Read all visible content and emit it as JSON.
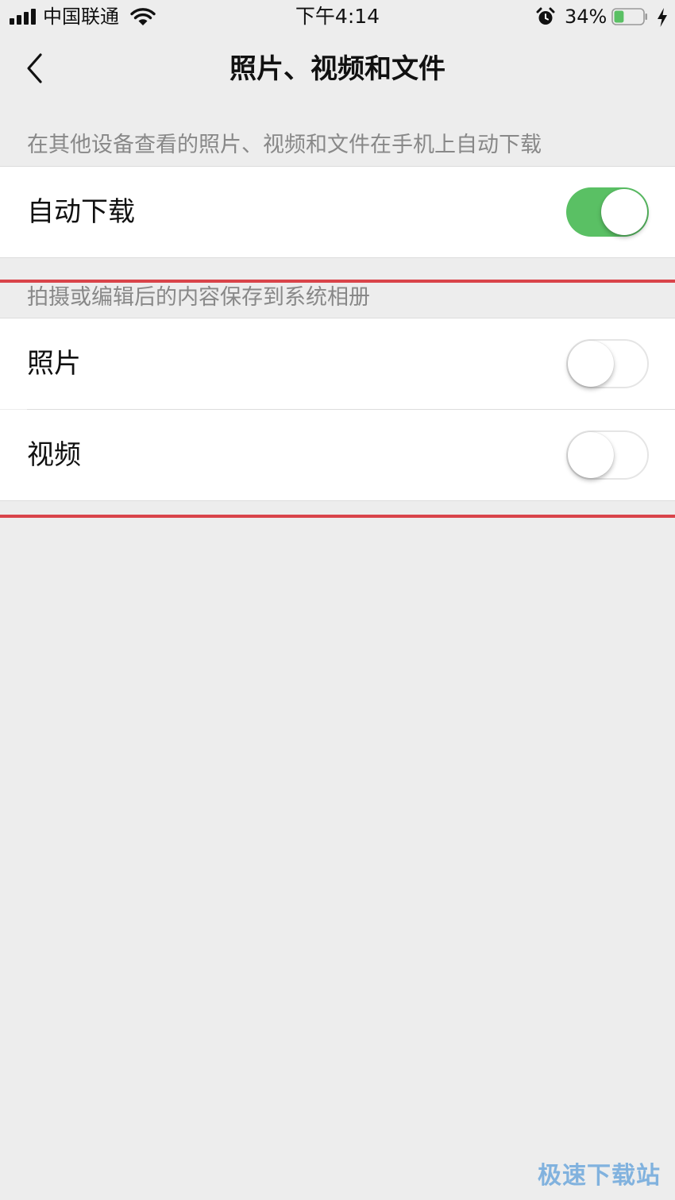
{
  "status_bar": {
    "carrier": "中国联通",
    "time": "下午4:14",
    "battery_percent": "34%",
    "battery_level": 0.34,
    "icons": [
      "signal-icon",
      "wifi-icon",
      "alarm-icon",
      "battery-icon",
      "charging-bolt-icon"
    ]
  },
  "nav": {
    "title": "照片、视频和文件",
    "back_icon": "chevron-left-icon"
  },
  "section_auto_download": {
    "header": "在其他设备查看的照片、视频和文件在手机上自动下载",
    "cell": {
      "label": "自动下载",
      "switch_on": true
    }
  },
  "section_save_album": {
    "header": "拍摄或编辑后的内容保存到系统相册",
    "cells": [
      {
        "label": "照片",
        "switch_on": false
      },
      {
        "label": "视频",
        "switch_on": false
      }
    ]
  },
  "watermark": "极速下载站",
  "colors": {
    "background": "#ededed",
    "switch_on": "#5ac064",
    "highlight_line": "#d9444a",
    "battery_fill": "#5ac064"
  }
}
